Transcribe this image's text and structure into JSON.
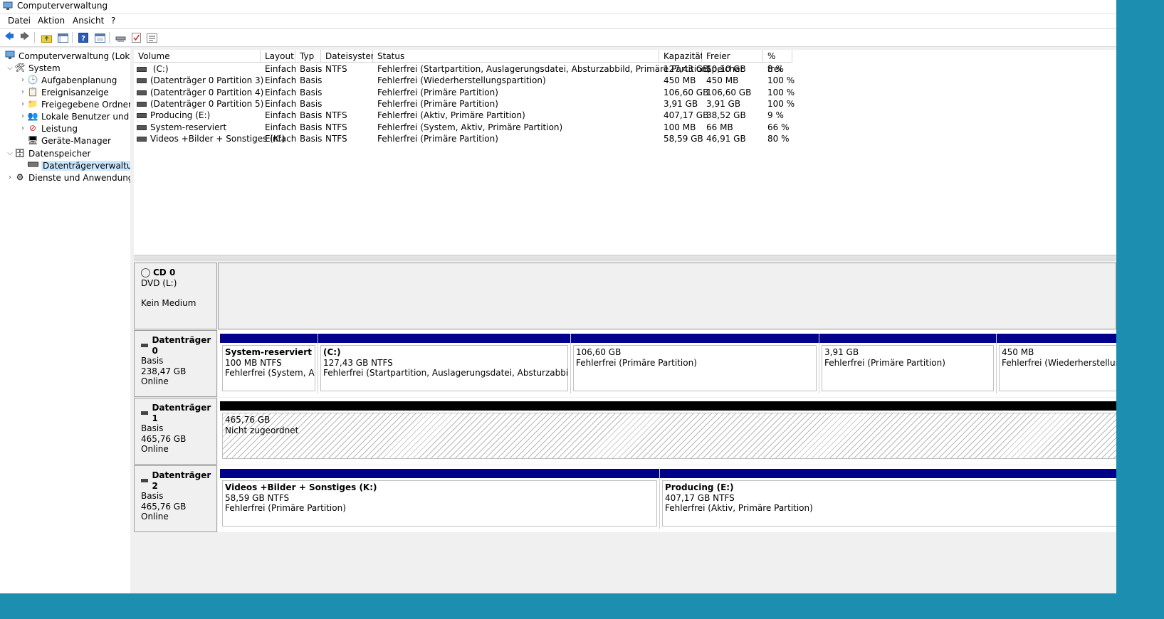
{
  "window": {
    "title": "Computerverwaltung"
  },
  "menu": [
    "Datei",
    "Aktion",
    "Ansicht",
    "?"
  ],
  "toolbar": [
    "back-icon",
    "forward-icon",
    "up-folder-icon",
    "console-tree-icon",
    "help-icon",
    "properties-icon",
    "connect-icon",
    "check-icon",
    "list-icon"
  ],
  "tree": {
    "root": "Computerverwaltung (Lokal)",
    "system": "System",
    "aufgaben": "Aufgabenplanung",
    "ereignis": "Ereignisanzeige",
    "freigabe": "Freigegebene Ordner",
    "lokal": "Lokale Benutzer und Gru",
    "leistung": "Leistung",
    "geraete": "Geräte-Manager",
    "datenspeicher": "Datenspeicher",
    "datentraeger": "Datenträgerverwaltung",
    "dienste": "Dienste und Anwendungen"
  },
  "columns": [
    "Volume",
    "Layout",
    "Typ",
    "Dateisystem",
    "Status",
    "Kapazität",
    "Freier Speicher",
    "% frei"
  ],
  "volumes": [
    {
      "volume": " (C:)",
      "layout": "Einfach",
      "typ": "Basis",
      "fs": "NTFS",
      "status": "Fehlerfrei (Startpartition, Auslagerungsdatei, Absturzabbild, Primäre Partition)",
      "cap": "127,43 GB",
      "free": "10,10 GB",
      "pct": "8 %"
    },
    {
      "volume": "(Datenträger 0 Partition 3)",
      "layout": "Einfach",
      "typ": "Basis",
      "fs": "",
      "status": "Fehlerfrei (Wiederherstellungspartition)",
      "cap": "450 MB",
      "free": "450 MB",
      "pct": "100 %"
    },
    {
      "volume": "(Datenträger 0 Partition 4)",
      "layout": "Einfach",
      "typ": "Basis",
      "fs": "",
      "status": "Fehlerfrei (Primäre Partition)",
      "cap": "106,60 GB",
      "free": "106,60 GB",
      "pct": "100 %"
    },
    {
      "volume": "(Datenträger 0 Partition 5)",
      "layout": "Einfach",
      "typ": "Basis",
      "fs": "",
      "status": "Fehlerfrei (Primäre Partition)",
      "cap": "3,91 GB",
      "free": "3,91 GB",
      "pct": "100 %"
    },
    {
      "volume": "Producing (E:)",
      "layout": "Einfach",
      "typ": "Basis",
      "fs": "NTFS",
      "status": "Fehlerfrei (Aktiv, Primäre Partition)",
      "cap": "407,17 GB",
      "free": "38,52 GB",
      "pct": "9 %"
    },
    {
      "volume": "System-reserviert",
      "layout": "Einfach",
      "typ": "Basis",
      "fs": "NTFS",
      "status": "Fehlerfrei (System, Aktiv, Primäre Partition)",
      "cap": "100 MB",
      "free": "66 MB",
      "pct": "66 %"
    },
    {
      "volume": "Videos +Bilder + Sonstiges (K:)",
      "layout": "Einfach",
      "typ": "Basis",
      "fs": "NTFS",
      "status": "Fehlerfrei (Primäre Partition)",
      "cap": "58,59 GB",
      "free": "46,91 GB",
      "pct": "80 %"
    }
  ],
  "cd0": {
    "name": "CD 0",
    "line1": "DVD (L:)",
    "line2": "Kein Medium"
  },
  "disk0": {
    "name": "Datenträger 0",
    "type": "Basis",
    "size": "238,47 GB",
    "state": "Online",
    "parts": [
      {
        "name": "System-reserviert",
        "size": "100 MB NTFS",
        "status": "Fehlerfrei (System, Aktiv,"
      },
      {
        "name": " (C:)",
        "size": "127,43 GB NTFS",
        "status": "Fehlerfrei (Startpartition, Auslagerungsdatei, Absturzabbild, Primäre"
      },
      {
        "name": "",
        "size": "106,60 GB",
        "status": "Fehlerfrei (Primäre Partition)"
      },
      {
        "name": "",
        "size": "3,91 GB",
        "status": "Fehlerfrei (Primäre Partition)"
      },
      {
        "name": "",
        "size": "450 MB",
        "status": "Fehlerfrei (Wiederherstellungspa"
      }
    ]
  },
  "disk1": {
    "name": "Datenträger 1",
    "type": "Basis",
    "size": "465,76 GB",
    "state": "Online",
    "part": {
      "size": "465,76 GB",
      "status": "Nicht zugeordnet"
    }
  },
  "disk2": {
    "name": "Datenträger 2",
    "type": "Basis",
    "size": "465,76 GB",
    "state": "Online",
    "parts": [
      {
        "name": "Videos +Bilder + Sonstiges  (K:)",
        "size": "58,59 GB NTFS",
        "status": "Fehlerfrei (Primäre Partition)"
      },
      {
        "name": "Producing  (E:)",
        "size": "407,17 GB NTFS",
        "status": "Fehlerfrei (Aktiv, Primäre Partition)"
      }
    ]
  },
  "colors": {
    "primary_partition": "#00008b",
    "unallocated": "#000000",
    "selection": "#cce8ff",
    "desktop": "#1c8fb0"
  }
}
